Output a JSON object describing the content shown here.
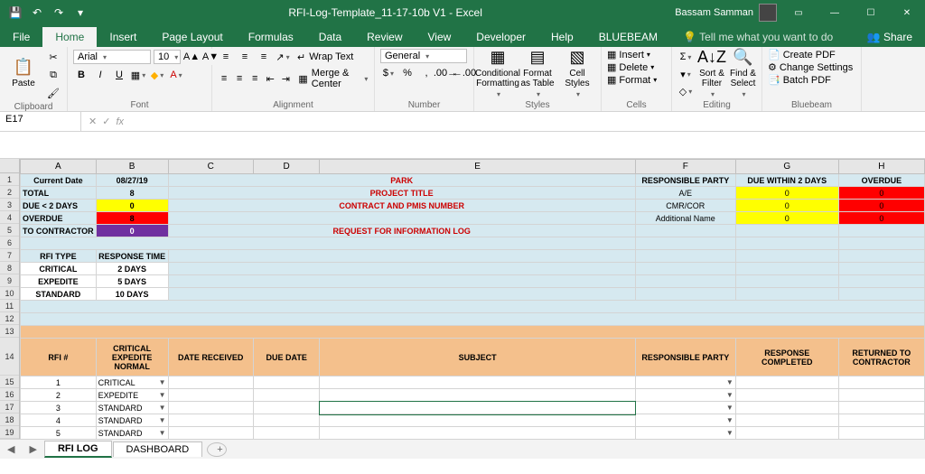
{
  "titlebar": {
    "filename": "RFI-Log-Template_11-17-10b V1  -  Excel",
    "user": "Bassam Samman"
  },
  "tabs": {
    "file": "File",
    "home": "Home",
    "insert": "Insert",
    "pagelayout": "Page Layout",
    "formulas": "Formulas",
    "data": "Data",
    "review": "Review",
    "view": "View",
    "developer": "Developer",
    "help": "Help",
    "bluebeam": "BLUEBEAM",
    "tellme": "Tell me what you want to do",
    "share": "Share"
  },
  "ribbon": {
    "clipboard": {
      "paste": "Paste",
      "label": "Clipboard"
    },
    "font": {
      "name": "Arial",
      "size": "10",
      "label": "Font"
    },
    "alignment": {
      "wrap": "Wrap Text",
      "merge": "Merge & Center",
      "label": "Alignment"
    },
    "number": {
      "format": "General",
      "label": "Number"
    },
    "styles": {
      "cond": "Conditional Formatting",
      "fat": "Format as Table",
      "cell": "Cell Styles",
      "label": "Styles"
    },
    "cells": {
      "insert": "Insert",
      "delete": "Delete",
      "format": "Format",
      "label": "Cells"
    },
    "editing": {
      "sort": "Sort & Filter",
      "find": "Find & Select",
      "label": "Editing"
    },
    "bluebeam": {
      "pdf": "Create PDF",
      "settings": "Change Settings",
      "batch": "Batch PDF",
      "label": "Bluebeam"
    }
  },
  "namebox": "E17",
  "cols": {
    "A": "A",
    "B": "B",
    "C": "C",
    "D": "D",
    "E": "E",
    "F": "F",
    "G": "G",
    "H": "H"
  },
  "rows": {
    "r1": {
      "a": "Current Date",
      "b": "08/27/19",
      "e": "PARK",
      "f": "RESPONSIBLE PARTY",
      "g": "DUE WITHIN 2 DAYS",
      "h": "OVERDUE"
    },
    "r2": {
      "a": "TOTAL",
      "b": "8",
      "e": "PROJECT TITLE",
      "f": "A/E",
      "g": "0",
      "h": "0"
    },
    "r3": {
      "a": "DUE < 2 DAYS",
      "b": "0",
      "e": "CONTRACT AND PMIS NUMBER",
      "f": "CMR/COR",
      "g": "0",
      "h": "0"
    },
    "r4": {
      "a": "OVERDUE",
      "b": "8",
      "f": "Additional Name",
      "g": "0",
      "h": "0"
    },
    "r5": {
      "a": "TO CONTRACTOR",
      "b": "0",
      "e": "REQUEST FOR INFORMATION LOG"
    },
    "r7": {
      "a": "RFI TYPE",
      "b": "RESPONSE TIME"
    },
    "r8": {
      "a": "CRITICAL",
      "b": "2 DAYS"
    },
    "r9": {
      "a": "EXPEDITE",
      "b": "5 DAYS"
    },
    "r10": {
      "a": "STANDARD",
      "b": "10 DAYS"
    },
    "r14": {
      "a": "RFI #",
      "b": "CRITICAL EXPEDITE NORMAL",
      "c": "DATE RECEIVED",
      "d": "DUE DATE",
      "e": "SUBJECT",
      "f": "RESPONSIBLE PARTY",
      "g": "RESPONSE COMPLETED",
      "h": "RETURNED TO CONTRACTOR"
    },
    "dr": [
      {
        "n": "1",
        "t": "CRITICAL"
      },
      {
        "n": "2",
        "t": "EXPEDITE"
      },
      {
        "n": "3",
        "t": "STANDARD"
      },
      {
        "n": "4",
        "t": "STANDARD"
      },
      {
        "n": "5",
        "t": "STANDARD"
      }
    ]
  },
  "sheets": {
    "s1": "RFI LOG",
    "s2": "DASHBOARD"
  }
}
